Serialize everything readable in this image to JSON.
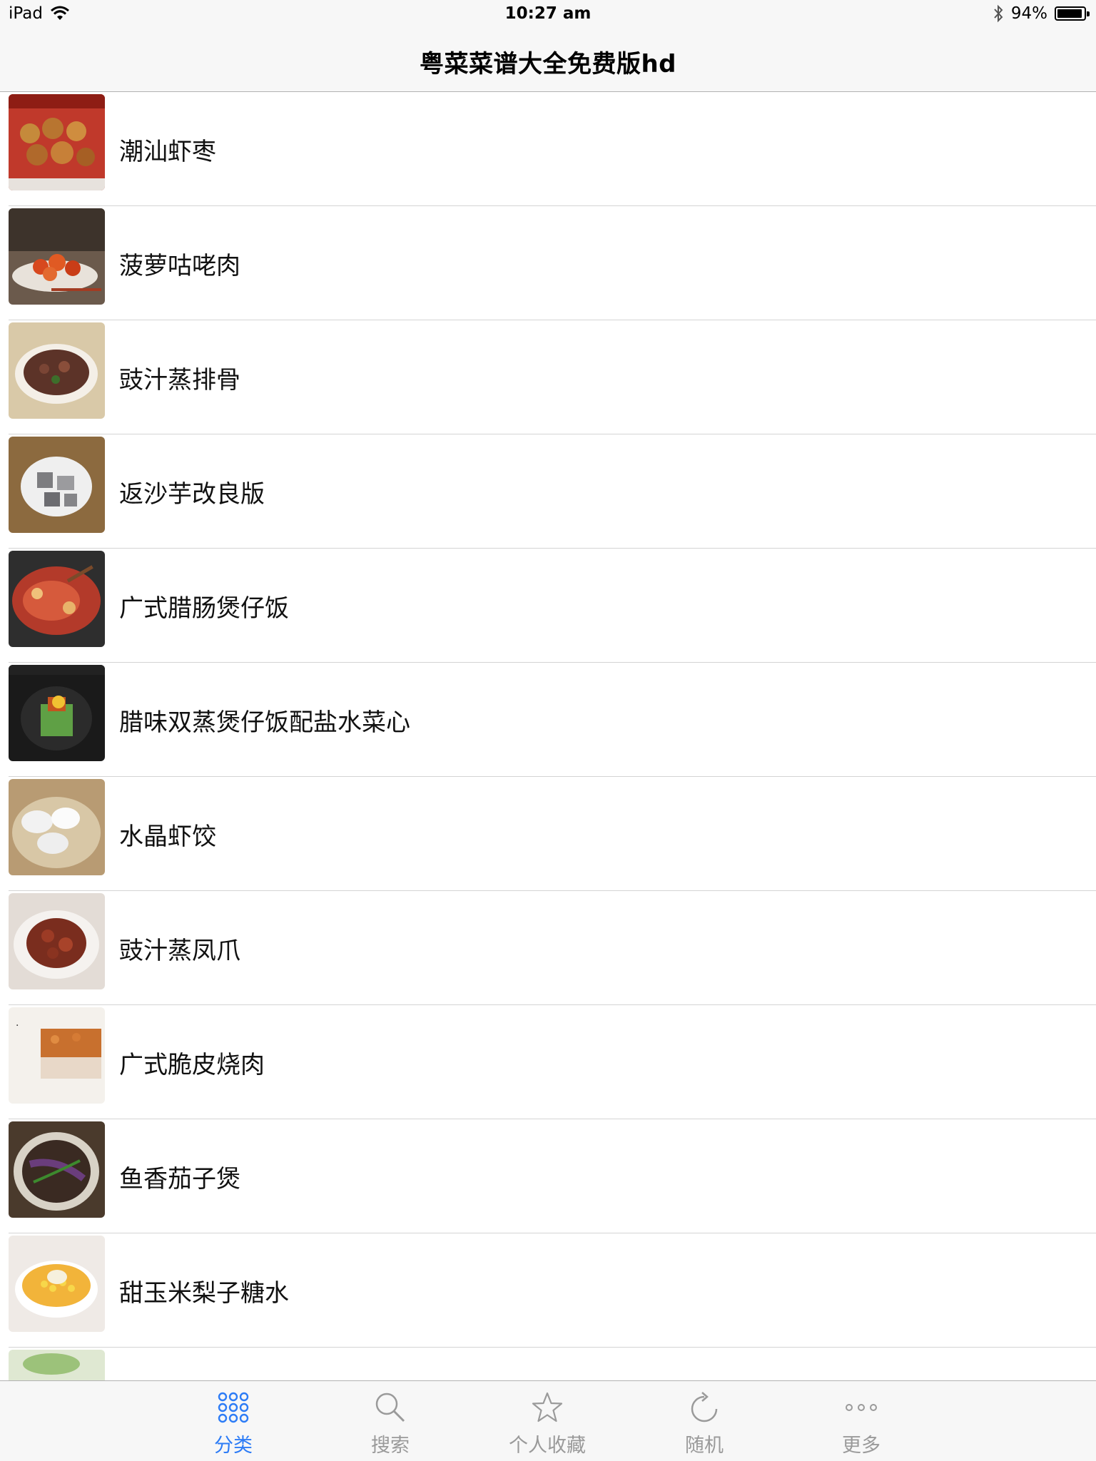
{
  "status_bar": {
    "device": "iPad",
    "time": "10:27 am",
    "battery": "94%",
    "battery_level": 0.94,
    "icons": [
      "wifi-icon",
      "bluetooth-icon",
      "battery-icon"
    ]
  },
  "nav": {
    "title": "粤菜菜谱大全免费版hd"
  },
  "recipes": [
    {
      "name": "潮汕虾枣"
    },
    {
      "name": "菠萝咕咾肉"
    },
    {
      "name": "豉汁蒸排骨"
    },
    {
      "name": "返沙芋改良版"
    },
    {
      "name": "广式腊肠煲仔饭"
    },
    {
      "name": "腊味双蒸煲仔饭配盐水菜心"
    },
    {
      "name": "水晶虾饺"
    },
    {
      "name": "豉汁蒸凤爪"
    },
    {
      "name": "广式脆皮烧肉"
    },
    {
      "name": "鱼香茄子煲"
    },
    {
      "name": "甜玉米梨子糖水"
    }
  ],
  "tabs": [
    {
      "label": "分类",
      "icon": "grid-dots-icon"
    },
    {
      "label": "搜索",
      "icon": "search-icon"
    },
    {
      "label": "个人收藏",
      "icon": "star-icon"
    },
    {
      "label": "随机",
      "icon": "refresh-icon"
    },
    {
      "label": "更多",
      "icon": "more-dots-icon"
    }
  ],
  "colors": {
    "accent": "#2d7cf6",
    "inactive": "#9a9a9a",
    "bar_bg": "#f7f7f7"
  }
}
